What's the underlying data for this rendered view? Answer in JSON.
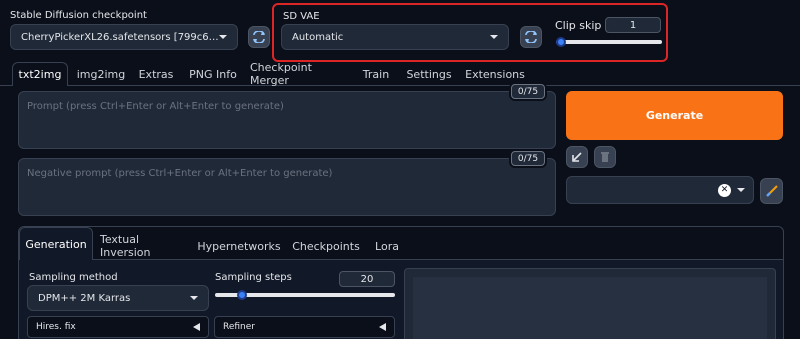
{
  "checkpoint": {
    "label": "Stable Diffusion checkpoint",
    "value": "CherryPickerXL26.safetensors [799c6f56e4]"
  },
  "vae": {
    "label": "SD VAE",
    "value": "Automatic"
  },
  "clip_skip": {
    "label": "Clip skip",
    "value": "1",
    "level_fraction": 0.0
  },
  "tabs": [
    {
      "label": "txt2img"
    },
    {
      "label": "img2img"
    },
    {
      "label": "Extras"
    },
    {
      "label": "PNG Info"
    },
    {
      "label": "Checkpoint Merger"
    },
    {
      "label": "Train"
    },
    {
      "label": "Settings"
    },
    {
      "label": "Extensions"
    }
  ],
  "prompt": {
    "placeholder": "Prompt (press Ctrl+Enter or Alt+Enter to generate)",
    "counter": "0/75"
  },
  "negative_prompt": {
    "placeholder": "Negative prompt (press Ctrl+Enter or Alt+Enter to generate)",
    "counter": "0/75"
  },
  "generate_label": "Generate",
  "subtabs": [
    {
      "label": "Generation"
    },
    {
      "label": "Textual Inversion"
    },
    {
      "label": "Hypernetworks"
    },
    {
      "label": "Checkpoints"
    },
    {
      "label": "Lora"
    }
  ],
  "sampling_method": {
    "label": "Sampling method",
    "value": "DPM++ 2M Karras"
  },
  "sampling_steps": {
    "label": "Sampling steps",
    "value": "20",
    "level_fraction": 0.13
  },
  "hires_fix_label": "Hires. fix",
  "refiner_label": "Refiner",
  "colors": {
    "accent": "#f97316",
    "highlight_border": "#dc2626",
    "slider": "#3b82f6"
  }
}
